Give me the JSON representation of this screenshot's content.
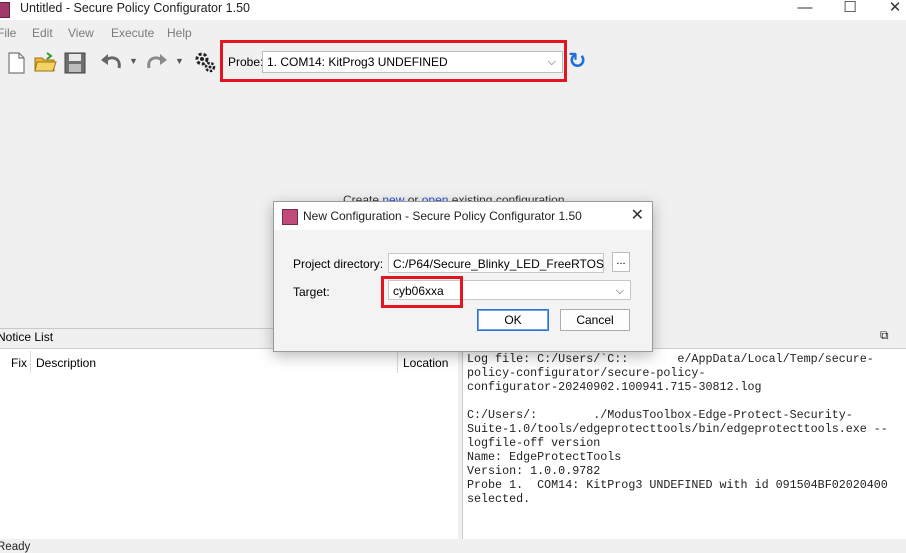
{
  "window": {
    "title": "Untitled - Secure Policy Configurator 1.50"
  },
  "menu": {
    "items": [
      "File",
      "Edit",
      "View",
      "Execute",
      "Help"
    ]
  },
  "toolbar": {
    "probe_label": "Probe:",
    "probe_value": "1.  COM14: KitProg3 UNDEFINED"
  },
  "workspace": {
    "hint_prefix": "Create",
    "hint_new": "new",
    "hint_or": "or",
    "hint_open": "open",
    "hint_suffix": "existing configuration"
  },
  "notice_list": {
    "title": "Notice List",
    "columns": [
      "Fix",
      "Description",
      "Location"
    ]
  },
  "log": {
    "lines": [
      "Log file: C:/Users/`C::       e/AppData/Local/Temp/secure-",
      "policy-configurator/secure-policy-",
      "configurator-20240902.100941.715-30812.log",
      "",
      "C:/Users/:        ./ModusToolbox-Edge-Protect-Security-",
      "Suite-1.0/tools/edgeprotecttools/bin/edgeprotecttools.exe --",
      "logfile-off version",
      "Name: EdgeProtectTools",
      "Version: 1.0.0.9782",
      "Probe 1.  COM14: KitProg3 UNDEFINED with id 091504BF02020400",
      "selected."
    ]
  },
  "status": {
    "text": "Ready"
  },
  "dialog": {
    "title": "New Configuration - Secure Policy Configurator 1.50",
    "project_dir_label": "Project directory:",
    "project_dir_value": "C:/P64/Secure_Blinky_LED_FreeRTOS",
    "browse_label": "...",
    "target_label": "Target:",
    "target_value": "cyb06xxa",
    "ok_label": "OK",
    "cancel_label": "Cancel"
  },
  "colors": {
    "highlight": "#e3151f",
    "link": "#1f4fd6",
    "refresh": "#1f6fd6"
  }
}
